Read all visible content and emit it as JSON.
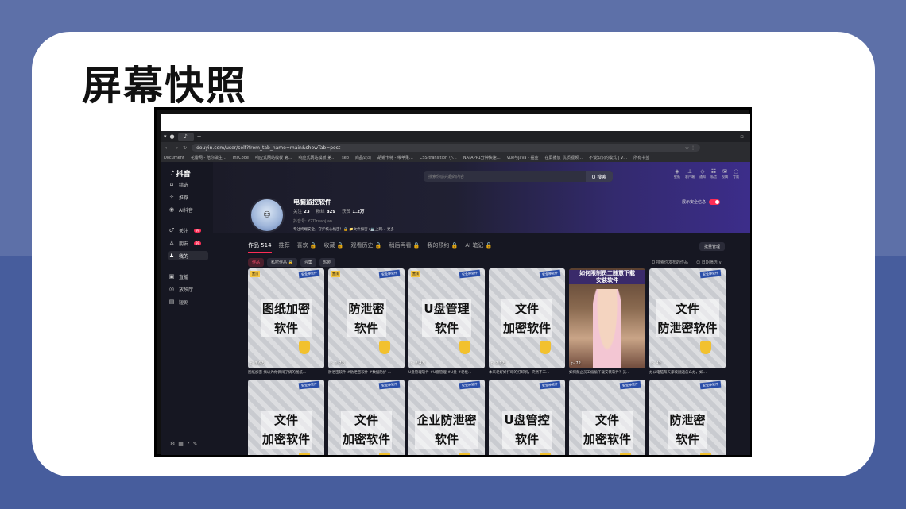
{
  "slide": {
    "title": "屏幕快照"
  },
  "browser": {
    "url": "douyin.com/user/self?from_tab_name=main&showTab=post",
    "bookmarks": [
      "Document",
      "花瓣网 - 陪你做生…",
      "InsCode",
      "响应式网站模板 第…",
      "响应式网站模板 第…",
      "seo",
      "商品公司",
      "胡锡卡特 - 带苹果…",
      "CSS transition 小…",
      "NATAPP1分钟快速…",
      "vue与java - 掘金",
      "在屏播放_优质视频…",
      "不谈知识的模式 | V…",
      "所有书签"
    ]
  },
  "sidebar": {
    "logo": "抖音",
    "items": [
      {
        "icon": "⌂",
        "label": "精选"
      },
      {
        "icon": "✧",
        "label": "推荐"
      },
      {
        "icon": "◉",
        "label": "AI抖音"
      },
      {
        "icon": "♂",
        "label": "关注",
        "badge": "99"
      },
      {
        "icon": "♙",
        "label": "朋友",
        "badge": "99"
      },
      {
        "icon": "♟",
        "label": "我的"
      },
      {
        "icon": "▣",
        "label": "直播"
      },
      {
        "icon": "◎",
        "label": "放映厅"
      },
      {
        "icon": "▤",
        "label": "短剧"
      }
    ]
  },
  "header": {
    "search_placeholder": "搜索你感兴趣的内容",
    "search_button": "Q 搜索",
    "icons": [
      {
        "glyph": "◈",
        "label": "壁纸"
      },
      {
        "glyph": "⊥",
        "label": "客户端"
      },
      {
        "glyph": "◇",
        "label": "通知"
      },
      {
        "glyph": "☷",
        "label": "私信"
      },
      {
        "glyph": "✉",
        "label": "投稿"
      },
      {
        "glyph": "◌",
        "label": "专属"
      }
    ]
  },
  "profile": {
    "name": "电脑监控软件",
    "follow_label": "关注",
    "follow": "23",
    "fans_label": "粉丝",
    "fans": "829",
    "likes_label": "获赞",
    "likes": "1.2万",
    "id": "抖音号: YZDruanjian",
    "desc": "专注终端安全，守护核心机密！🔒 📁文件加密+💻上网…  更多",
    "toggle_label": "展示安全信息"
  },
  "tabs": [
    "作品 514",
    "推荐",
    "喜欢 🔒",
    "收藏 🔒",
    "观看历史 🔒",
    "稍后再看 🔒",
    "我的预约 🔒",
    "AI 笔记 🔒"
  ],
  "manage_button": "批量管理",
  "filters": [
    "作品",
    "私密作品 🔒",
    "合集",
    "短剧"
  ],
  "right_filters": [
    "Q 搜索你发布的作品",
    "☺ 日期筛选 ∨"
  ],
  "videos": [
    {
      "text": "图纸加密\n软件",
      "tag": "置顶",
      "play": "▷ 3.6万",
      "caption": "图纸加密 搞以为你俩闹了俩的图纸…"
    },
    {
      "text": "防泄密\n软件",
      "tag": "置顶",
      "play": "▷ 1.7万",
      "caption": "防泄密软件 #防泄密软件 #数据防护 …"
    },
    {
      "text": "U盘管理\n软件",
      "tag": "置顶",
      "play": "▷ 2.4万",
      "caption": "U盘管理软件 #U盘管理 #U盘 #老板…"
    },
    {
      "text": "文件\n加密软件",
      "tag": "",
      "play": "▷ 2.1万",
      "caption": "本来老好好打印的打印机，突然不工…"
    },
    {
      "text": "",
      "tag": "",
      "play": "▷ 72",
      "caption": "如何禁止员工偷偷下载安装软件？员…",
      "photo": true,
      "photo_head": "如何限制员工随意下载\n安装软件"
    },
    {
      "text": "文件\n防泄密软件",
      "tag": "",
      "play": "▷ 42",
      "caption": "办公电脑每天都被翻遍怎么办，如…"
    },
    {
      "text": "文件\n加密软件",
      "tag": "",
      "play": "",
      "caption": ""
    },
    {
      "text": "文件\n加密软件",
      "tag": "",
      "play": "",
      "caption": ""
    },
    {
      "text": "企业防泄密\n软件",
      "tag": "",
      "play": "",
      "caption": ""
    },
    {
      "text": "U盘管控\n软件",
      "tag": "",
      "play": "",
      "caption": ""
    },
    {
      "text": "文件\n加密软件",
      "tag": "",
      "play": "",
      "caption": ""
    },
    {
      "text": "防泄密\n软件",
      "tag": "",
      "play": "",
      "caption": ""
    }
  ],
  "stamp_text": "安全神软件",
  "colors": {
    "accent": "#fe2c55",
    "card_bg": "#ffffff",
    "page_bg": "#5d70a8"
  }
}
